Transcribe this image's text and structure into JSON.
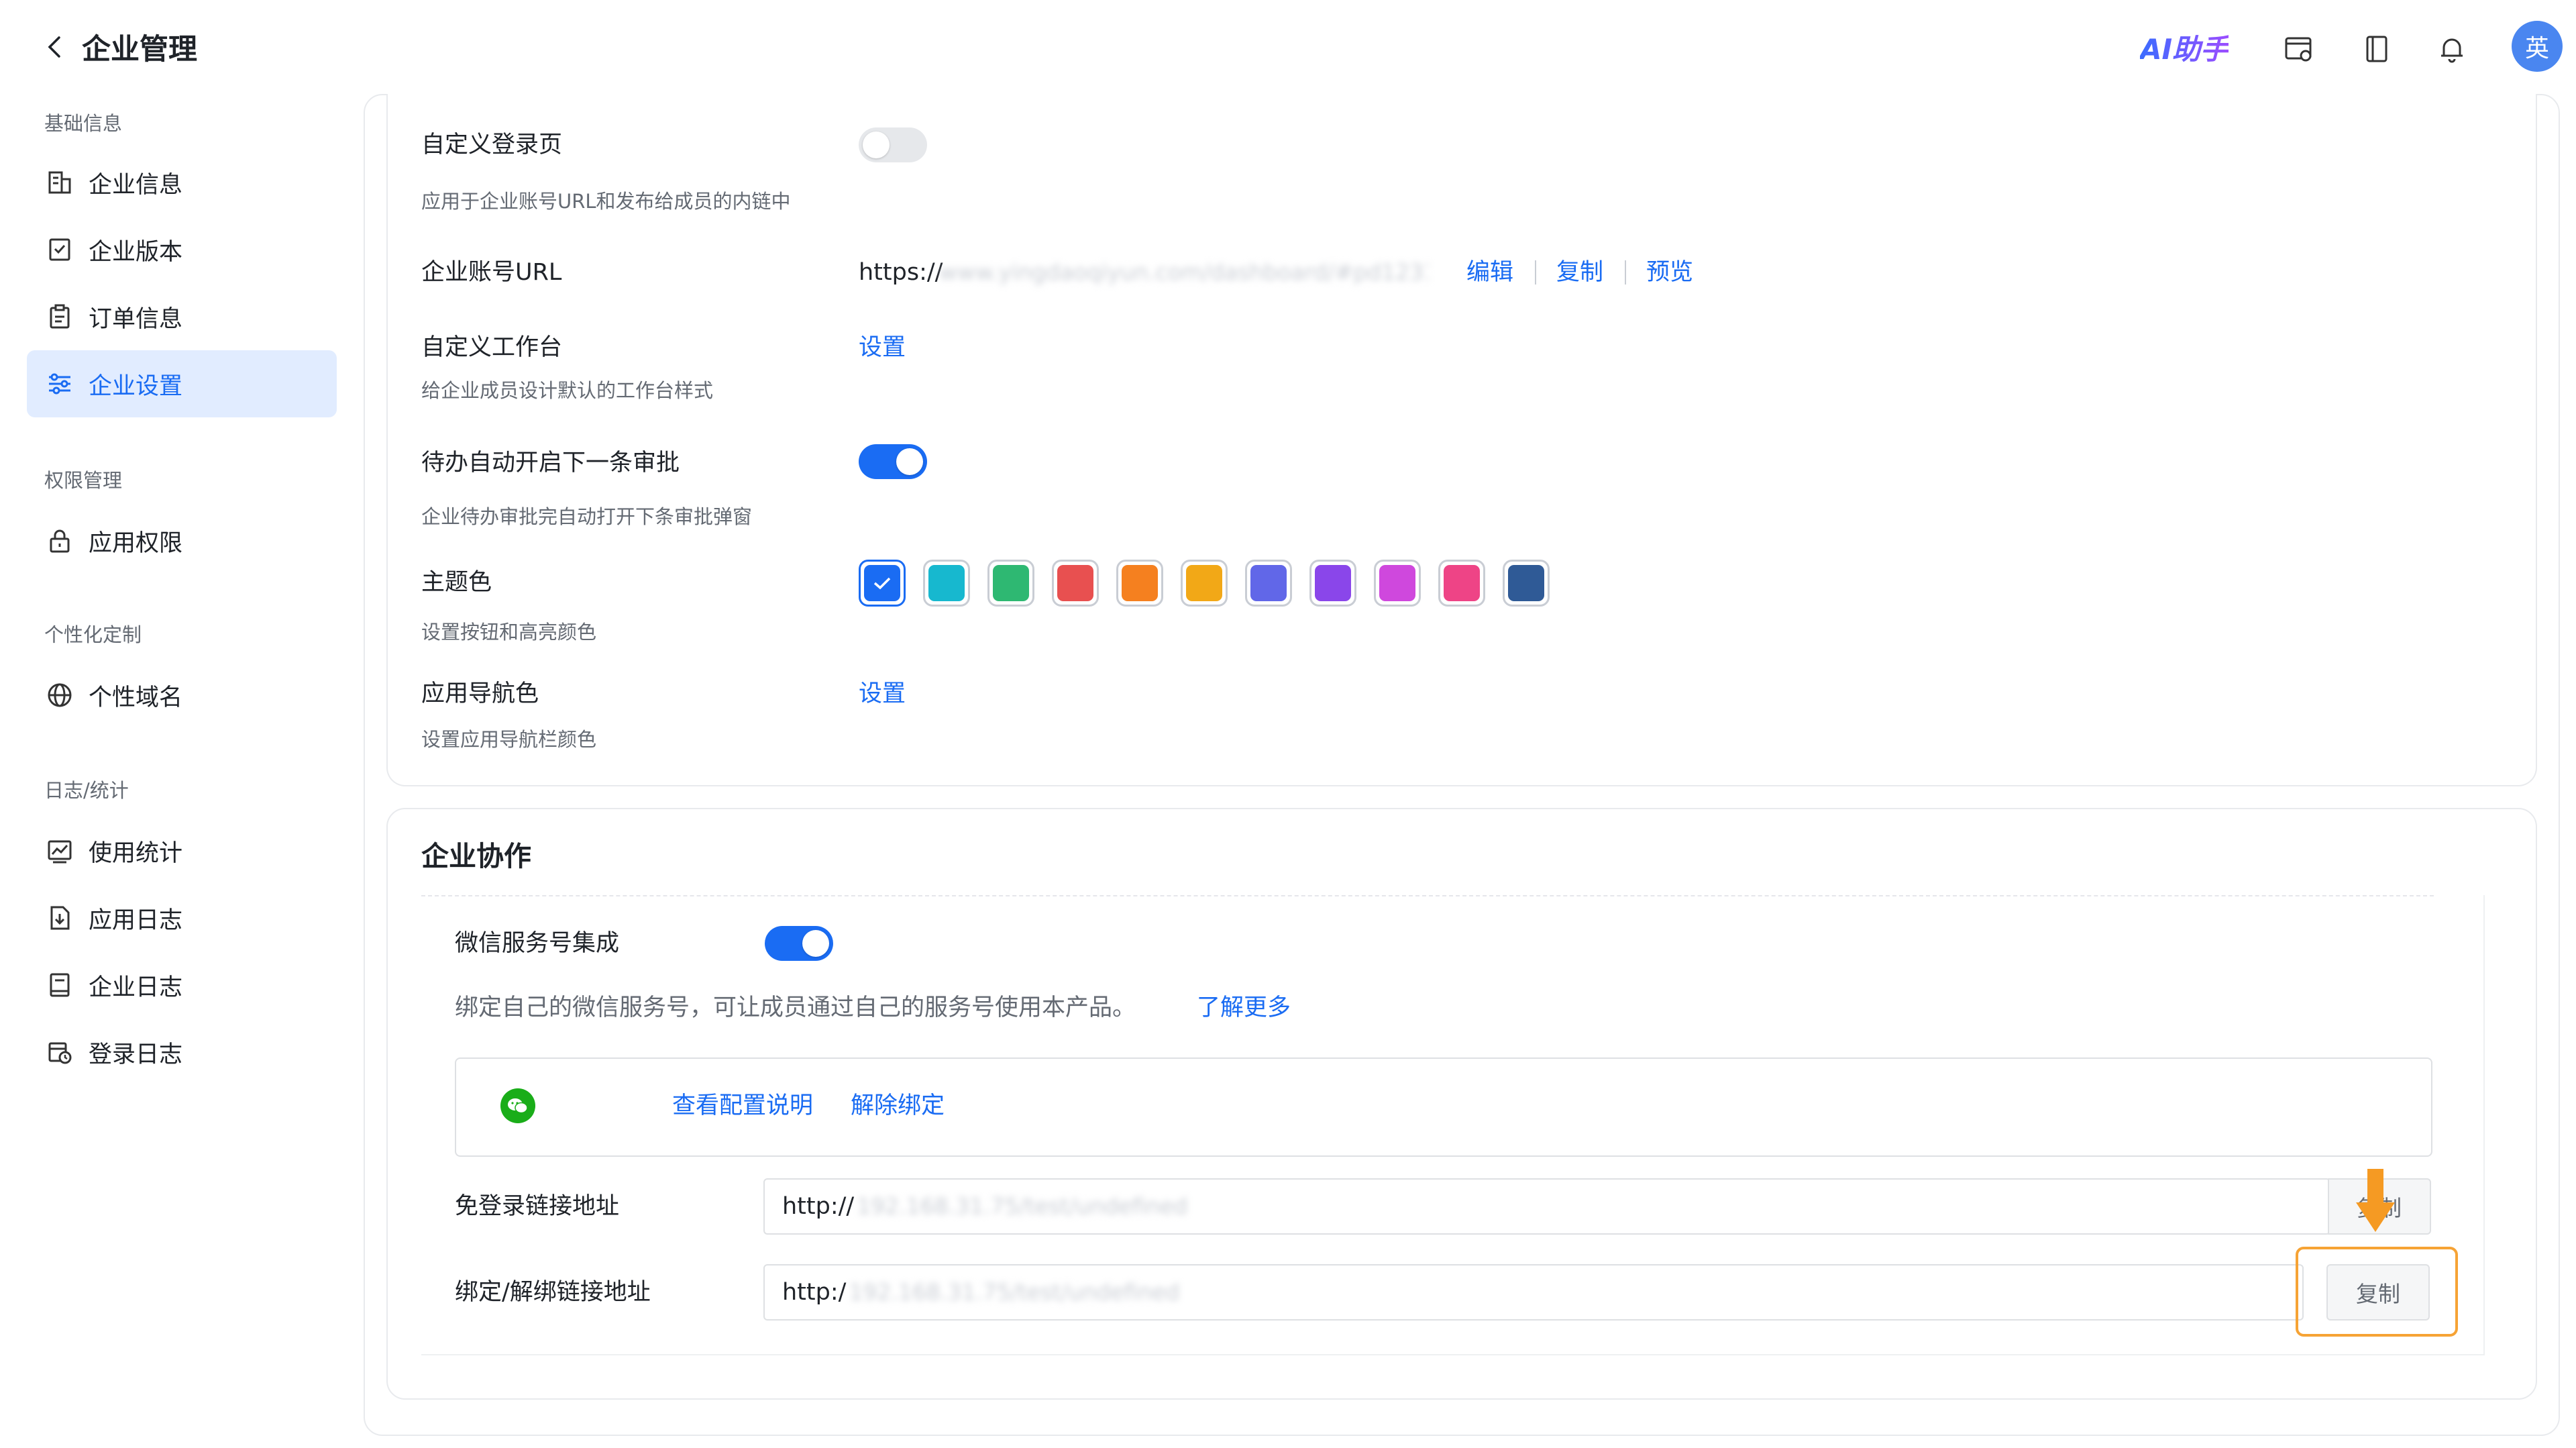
{
  "header": {
    "back_icon": "chevron-left-icon",
    "title": "企业管理",
    "ai_helper": "AI助手",
    "icons": [
      "browser-settings-icon",
      "book-icon",
      "bell-icon"
    ],
    "avatar_text": "英"
  },
  "sidebar": {
    "groups": [
      {
        "title": "基础信息",
        "items": [
          {
            "label": "企业信息",
            "icon": "building-icon"
          },
          {
            "label": "企业版本",
            "icon": "version-icon"
          },
          {
            "label": "订单信息",
            "icon": "clipboard-icon"
          },
          {
            "label": "企业设置",
            "icon": "settings-sliders-icon",
            "active": true
          }
        ]
      },
      {
        "title": "权限管理",
        "items": [
          {
            "label": "应用权限",
            "icon": "lock-icon"
          }
        ]
      },
      {
        "title": "个性化定制",
        "items": [
          {
            "label": "个性域名",
            "icon": "globe-icon"
          }
        ]
      },
      {
        "title": "日志/统计",
        "items": [
          {
            "label": "使用统计",
            "icon": "chart-icon"
          },
          {
            "label": "应用日志",
            "icon": "download-doc-icon"
          },
          {
            "label": "企业日志",
            "icon": "document-icon"
          },
          {
            "label": "登录日志",
            "icon": "calendar-clock-icon"
          }
        ]
      }
    ]
  },
  "settings": {
    "custom_login": {
      "label": "自定义登录页",
      "desc": "应用于企业账号URL和发布给成员的内链中",
      "enabled": false
    },
    "account_url": {
      "label": "企业账号URL",
      "prefix": "https://",
      "blurred": "www.yingdaoqiyun.com/dashboard/#pd123123",
      "edit": "编辑",
      "copy": "复制",
      "preview": "预览"
    },
    "custom_workbench": {
      "label": "自定义工作台",
      "desc": "给企业成员设计默认的工作台样式",
      "action": "设置"
    },
    "auto_next_approval": {
      "label": "待办自动开启下一条审批",
      "desc": "企业待办审批完自动打开下条审批弹窗",
      "enabled": true
    },
    "theme_color": {
      "label": "主题色",
      "desc": "设置按钮和高亮颜色",
      "colors": [
        "#1a6cf3",
        "#17b8cf",
        "#2eb872",
        "#e85050",
        "#f5801f",
        "#f2a817",
        "#6167e8",
        "#8a46ea",
        "#cf48dd",
        "#ee4486",
        "#2f5a96"
      ],
      "selected_index": 0
    },
    "nav_color": {
      "label": "应用导航色",
      "desc": "设置应用导航栏颜色",
      "action": "设置"
    }
  },
  "collaboration": {
    "title": "企业协作",
    "wechat_service": {
      "label": "微信服务号集成",
      "enabled": true,
      "desc": "绑定自己的微信服务号，可让成员通过自己的服务号使用本产品。",
      "learn_more": "了解更多",
      "wechat_icon": "wechat-icon",
      "view_config": "查看配置说明",
      "unbind": "解除绑定"
    },
    "login_free_link": {
      "label": "免登录链接地址",
      "prefix": "http://",
      "blurred": "192.168.31.75/test/undefined",
      "copy": "复制"
    },
    "bind_link": {
      "label": "绑定/解绑链接地址",
      "prefix": "http:/",
      "blurred": "192.168.31.75/test/undefined",
      "copy": "复制"
    },
    "annotation_arrow": "arrow-down-icon"
  },
  "colors": {
    "accent": "#1a6cf3",
    "highlight": "#f6a335",
    "arrow": "#f59a23"
  }
}
